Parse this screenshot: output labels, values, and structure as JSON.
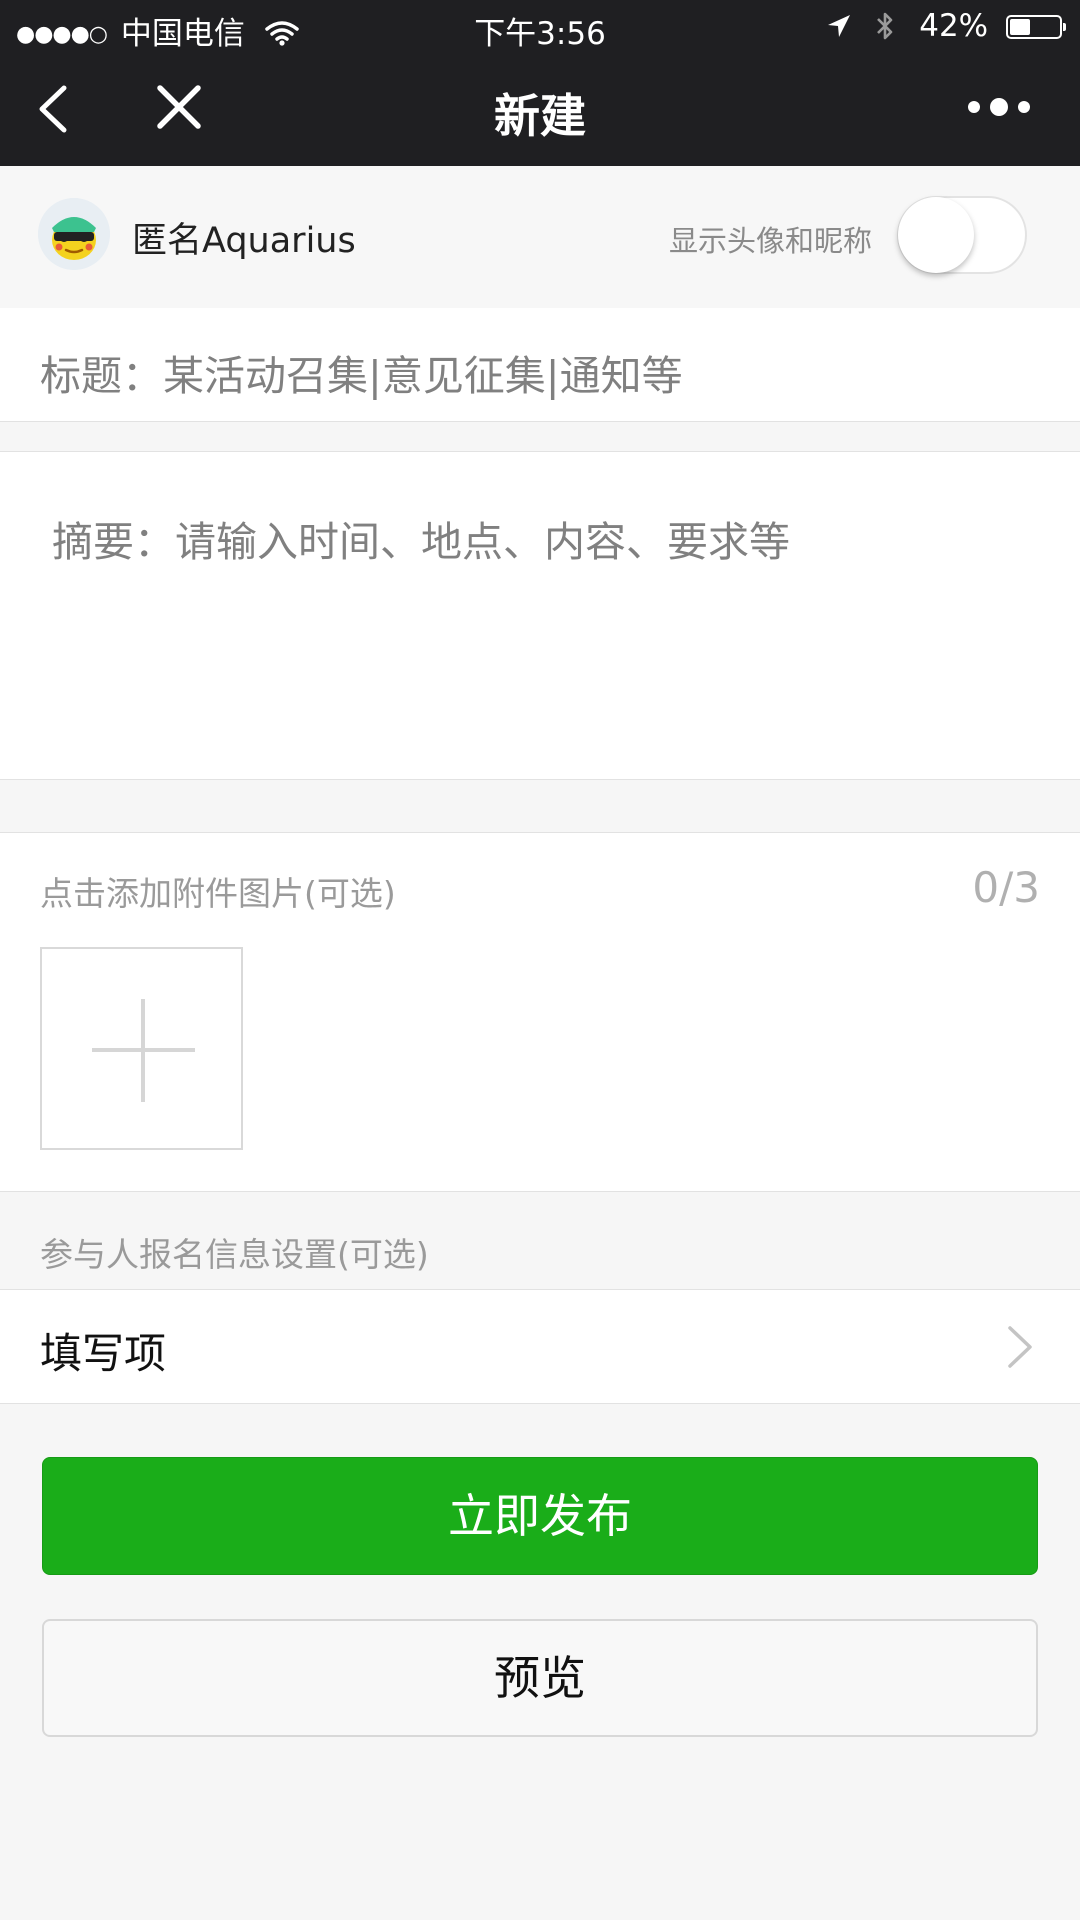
{
  "status_bar": {
    "signal": "●●●●○",
    "carrier": "中国电信",
    "time": "下午3:56",
    "battery_text": "42%",
    "battery_level": 0.42
  },
  "nav": {
    "title": "新建",
    "icons": [
      "back-arrow-icon",
      "close-icon",
      "more-icon"
    ]
  },
  "user": {
    "name": "匿名Aquarius",
    "toggle_label": "显示头像和昵称",
    "toggle_on": false
  },
  "form": {
    "title_placeholder": "标题：某活动召集|意见征集|通知等",
    "summary_placeholder": "摘要：请输入时间、地点、内容、要求等"
  },
  "attachment": {
    "hint": "点击添加附件图片(可选)",
    "count": "0/3"
  },
  "signup": {
    "caption": "参与人报名信息设置(可选)",
    "fill_label": "填写项"
  },
  "buttons": {
    "publish": "立即发布",
    "preview": "预览"
  },
  "colors": {
    "topbar": "#1f1f22",
    "primary": "#1aad19",
    "background": "#f6f6f6"
  }
}
